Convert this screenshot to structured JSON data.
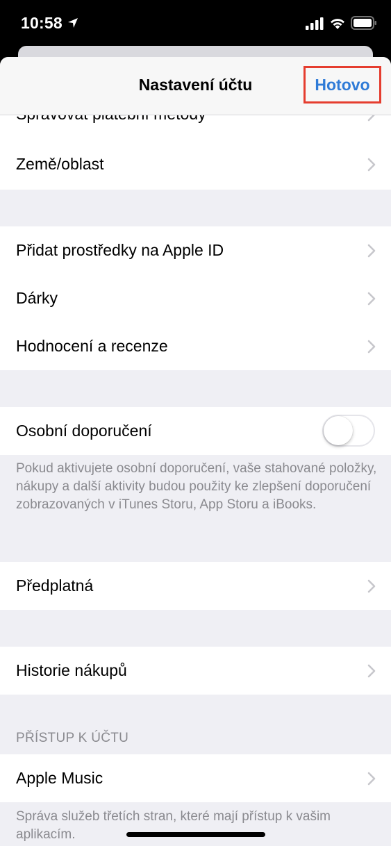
{
  "status_bar": {
    "time": "10:58",
    "location_icon": "location-arrow-icon",
    "signal_icon": "cellular-signal-icon",
    "wifi_icon": "wifi-icon",
    "battery_icon": "battery-icon"
  },
  "nav": {
    "title": "Nastavení účtu",
    "done_label": "Hotovo"
  },
  "colors": {
    "accent": "#2f7bd7",
    "highlight_border": "#e53d2f",
    "background": "#efeff4",
    "secondary_text": "#8a8a8f"
  },
  "group1": {
    "items": [
      {
        "label": "Spravovat platební metody"
      },
      {
        "label": "Země/oblast"
      }
    ]
  },
  "group2": {
    "items": [
      {
        "label": "Přidat prostředky na Apple ID"
      },
      {
        "label": "Dárky"
      },
      {
        "label": "Hodnocení a recenze"
      }
    ]
  },
  "personal": {
    "label": "Osobní doporučení",
    "toggle_on": false,
    "note": "Pokud aktivujete osobní doporučení, vaše stahované položky, nákupy a další aktivity budou použity ke zlepšení doporučení zobrazovaných v iTunes Storu, App Storu a iBooks."
  },
  "subscriptions": {
    "label": "Předplatná"
  },
  "history": {
    "label": "Historie nákupů"
  },
  "account_access": {
    "header": "PŘÍSTUP K ÚČTU",
    "item_label": "Apple Music",
    "note": "Správa služeb třetích stran, které mají přístup k vašim aplikacím."
  }
}
